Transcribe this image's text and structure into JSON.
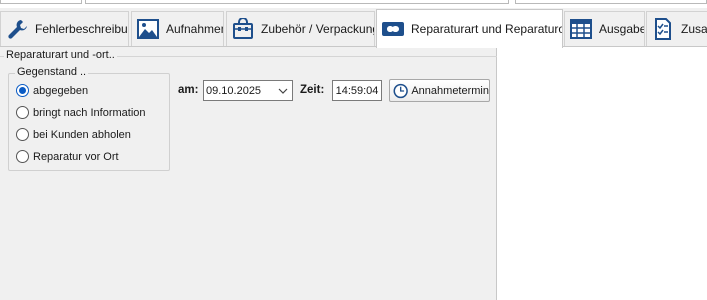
{
  "tabs": [
    {
      "label": "Fehlerbeschreibung",
      "icon": "wrench-icon",
      "active": false
    },
    {
      "label": "Aufnahmen",
      "icon": "image-icon",
      "active": false
    },
    {
      "label": "Zubehör / Verpackung",
      "icon": "bag-icon",
      "active": false
    },
    {
      "label": "Reparaturart und Reparaturort",
      "icon": "repair-type-icon",
      "active": true
    },
    {
      "label": "Ausgabe",
      "icon": "table-icon",
      "active": false
    },
    {
      "label": "Zusat",
      "icon": "checklist-icon",
      "active": false
    }
  ],
  "group": {
    "title": "Reparaturart und -ort..",
    "subgroup_title": "Gegenstand ..",
    "options": [
      {
        "label": "abgegeben",
        "checked": true
      },
      {
        "label": "bringt nach Information",
        "checked": false
      },
      {
        "label": "bei Kunden abholen",
        "checked": false
      },
      {
        "label": "Reparatur vor Ort",
        "checked": false
      }
    ]
  },
  "date": {
    "label": "am:",
    "value": "09.10.2025"
  },
  "time": {
    "label": "Zeit:",
    "value": "14:59:04"
  },
  "appointment_button": {
    "label": "Annahmetermin",
    "icon": "clock-icon"
  },
  "colors": {
    "accent": "#0a5bc4",
    "panel": "#f0f0f0",
    "icon_blue": "#1e4f8c"
  }
}
